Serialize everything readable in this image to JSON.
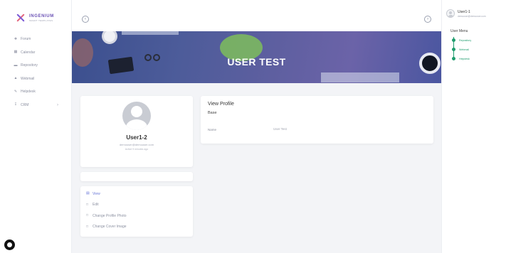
{
  "brand": {
    "name": "INGENIUM",
    "tagline": "SMART TEMPLATES"
  },
  "sidebar": {
    "items": [
      {
        "label": "Forum",
        "icon": "forum-icon"
      },
      {
        "label": "Calendar",
        "icon": "calendar-icon"
      },
      {
        "label": "Repository",
        "icon": "folder-icon"
      },
      {
        "label": "Webmail",
        "icon": "mail-icon"
      },
      {
        "label": "Helpdesk",
        "icon": "wrench-icon"
      },
      {
        "label": "CRM",
        "icon": "crm-icon",
        "has_submenu": true
      }
    ]
  },
  "banner": {
    "title": "USER TEST"
  },
  "profile": {
    "name": "User1-2",
    "email": "demouser@demouser.com",
    "active": "Active 9 minutes ago"
  },
  "actions": [
    {
      "label": "View",
      "active": true
    },
    {
      "label": "Edit",
      "active": false
    },
    {
      "label": "Change Profile Photo",
      "active": false
    },
    {
      "label": "Change Cover Image",
      "active": false
    }
  ],
  "view_profile": {
    "title": "View Profile",
    "section": "Base",
    "fields": [
      {
        "label": "Name",
        "value": "User Test"
      }
    ]
  },
  "right_panel": {
    "user_name": "User1-1",
    "user_email": "demouser@demouser.com",
    "menu_title": "User Menu",
    "menu_items": [
      {
        "label": "Repository"
      },
      {
        "label": "Webmail"
      },
      {
        "label": "Helpdesk"
      }
    ]
  },
  "colors": {
    "accent_green": "#1f9d6e",
    "accent_purple": "#6b52b5",
    "link_blue": "#6c7ad8"
  }
}
